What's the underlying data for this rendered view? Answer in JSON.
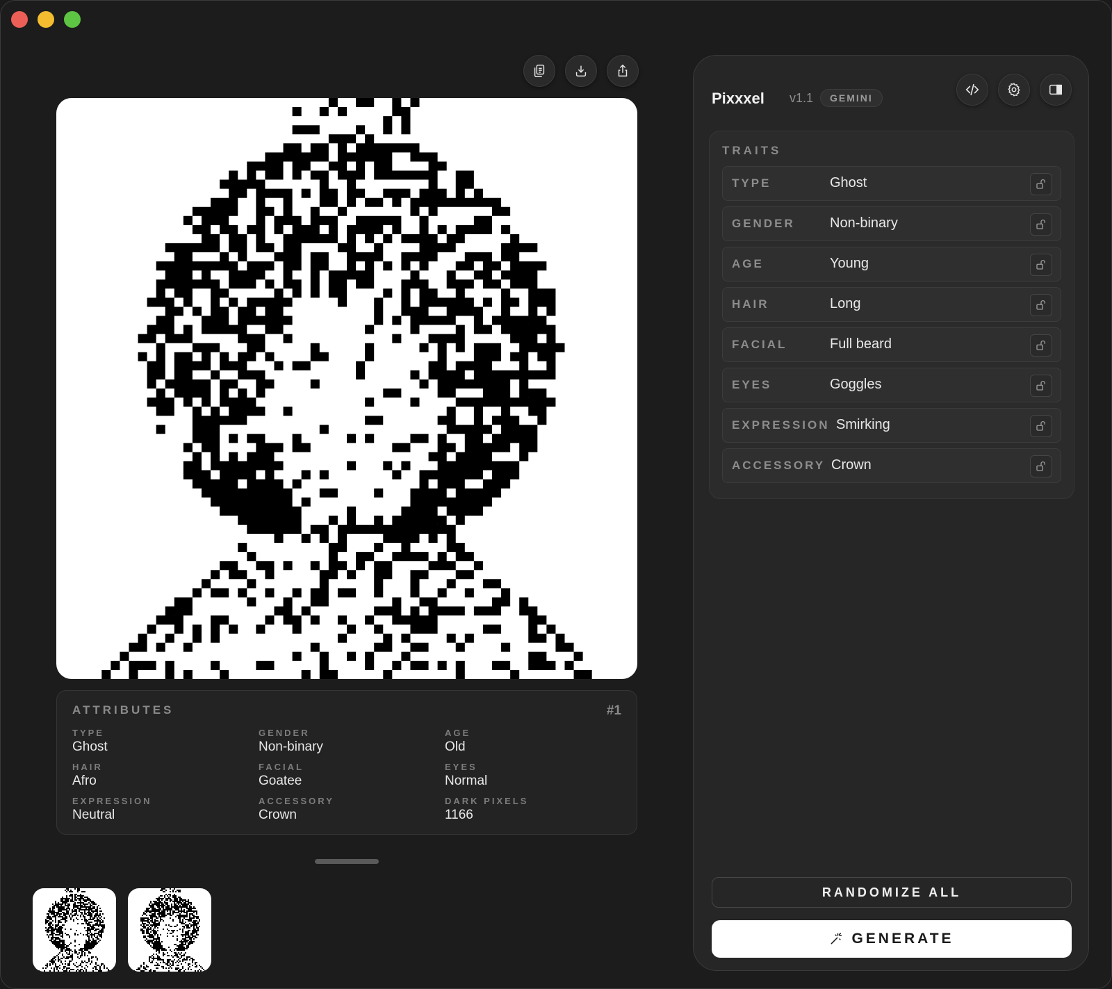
{
  "app": {
    "name": "Pixxxel",
    "version": "v1.1",
    "model": "GEMINI"
  },
  "toolbar": {
    "icons": [
      "copy-icon",
      "download-icon",
      "share-icon"
    ]
  },
  "header_actions": {
    "icons": [
      "code-icon",
      "gear-icon",
      "sidebar-icon"
    ]
  },
  "traits": {
    "title": "TRAITS",
    "rows": [
      {
        "key": "TYPE",
        "value": "Ghost"
      },
      {
        "key": "GENDER",
        "value": "Non-binary"
      },
      {
        "key": "AGE",
        "value": "Young"
      },
      {
        "key": "HAIR",
        "value": "Long"
      },
      {
        "key": "FACIAL",
        "value": "Full beard"
      },
      {
        "key": "EYES",
        "value": "Goggles"
      },
      {
        "key": "EXPRESSION",
        "value": "Smirking"
      },
      {
        "key": "ACCESSORY",
        "value": "Crown"
      }
    ]
  },
  "attributes": {
    "title": "ATTRIBUTES",
    "index": "#1",
    "items": [
      {
        "key": "TYPE",
        "value": "Ghost"
      },
      {
        "key": "GENDER",
        "value": "Non-binary"
      },
      {
        "key": "AGE",
        "value": "Old"
      },
      {
        "key": "HAIR",
        "value": "Afro"
      },
      {
        "key": "FACIAL",
        "value": "Goatee"
      },
      {
        "key": "EYES",
        "value": "Normal"
      },
      {
        "key": "EXPRESSION",
        "value": "Neutral"
      },
      {
        "key": "ACCESSORY",
        "value": "Crown"
      },
      {
        "key": "DARK PIXELS",
        "value": "1166"
      }
    ]
  },
  "actions": {
    "randomize": "RANDOMIZE ALL",
    "generate": "GENERATE"
  },
  "colors": {
    "background": "#1c1c1c",
    "panel": "#262626",
    "canvas": "#ffffff",
    "pixel": "#000000"
  }
}
